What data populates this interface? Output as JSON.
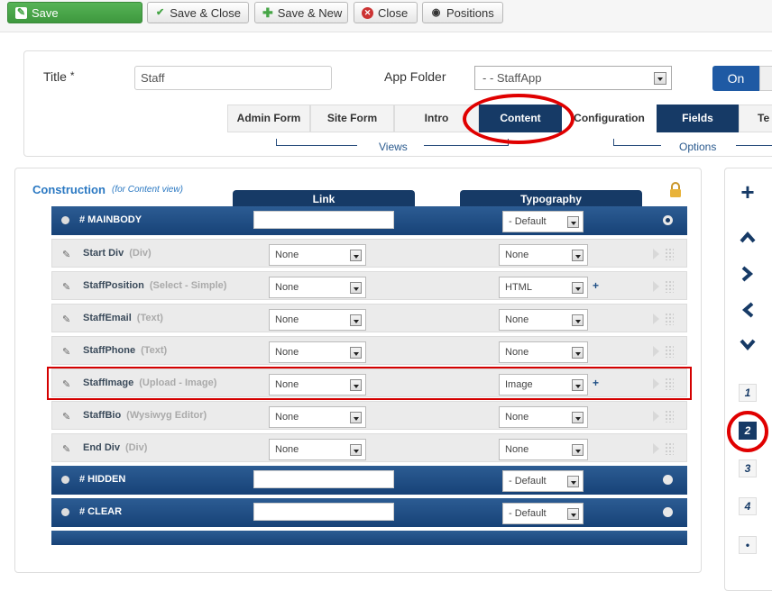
{
  "toolbar": {
    "save": "Save",
    "save_close": "Save & Close",
    "save_new": "Save & New",
    "close": "Close",
    "positions": "Positions"
  },
  "header": {
    "title_label": "Title",
    "required_mark": "*",
    "title_value": "Staff",
    "app_folder_label": "App Folder",
    "app_folder_value": "- - StaffApp",
    "toggle_on": "On"
  },
  "tabs": [
    "Admin Form",
    "Site Form",
    "Intro",
    "Content",
    "Configuration",
    "Fields",
    "Te"
  ],
  "groups": {
    "views": "Views",
    "options": "Options"
  },
  "construction": {
    "title": "Construction",
    "subtitle": "(for Content view)",
    "col_link": "Link",
    "col_typography": "Typography"
  },
  "rows": [
    {
      "name": "# MAINBODY",
      "type": "",
      "link": "",
      "typography": "- Default"
    },
    {
      "name": "Start Div",
      "type": "(Div)",
      "link": "None",
      "typography": "None"
    },
    {
      "name": "StaffPosition",
      "type": "(Select - Simple)",
      "link": "None",
      "typography": "HTML",
      "plus": "+"
    },
    {
      "name": "StaffEmail",
      "type": "(Text)",
      "link": "None",
      "typography": "None"
    },
    {
      "name": "StaffPhone",
      "type": "(Text)",
      "link": "None",
      "typography": "None"
    },
    {
      "name": "StaffImage",
      "type": "(Upload - Image)",
      "link": "None",
      "typography": "Image",
      "plus": "+"
    },
    {
      "name": "StaffBio",
      "type": "(Wysiwyg Editor)",
      "link": "None",
      "typography": "None"
    },
    {
      "name": "End Div",
      "type": "(Div)",
      "link": "None",
      "typography": "None"
    },
    {
      "name": "# HIDDEN",
      "type": "",
      "link": "",
      "typography": "- Default"
    },
    {
      "name": "# CLEAR",
      "type": "",
      "link": "",
      "typography": "- Default"
    }
  ],
  "side": {
    "add": "+",
    "pages": [
      "1",
      "2",
      "3",
      "4",
      "•"
    ]
  },
  "colors": {
    "accent": "#163a66",
    "save_green": "#46a546",
    "annotation_red": "#e00000"
  }
}
